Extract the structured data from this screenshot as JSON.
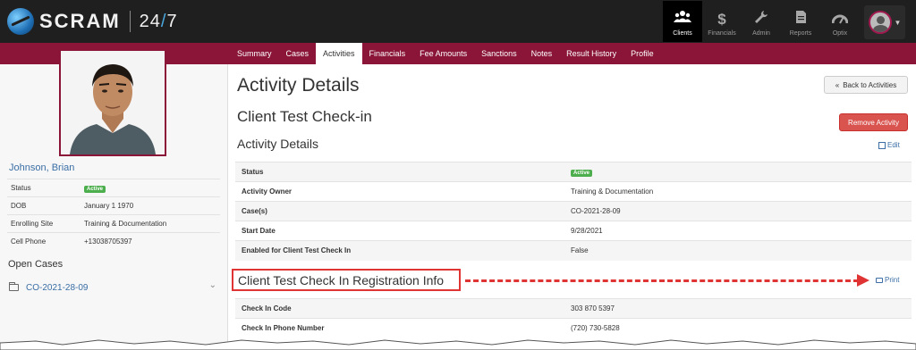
{
  "brand": {
    "name": "SCRAM",
    "suffix_1": "24",
    "slash": "/",
    "suffix_2": "7"
  },
  "nav": {
    "items": [
      {
        "label": "Clients",
        "icon": "users-icon",
        "active": true
      },
      {
        "label": "Financials",
        "icon": "dollar-icon",
        "active": false
      },
      {
        "label": "Admin",
        "icon": "wrench-icon",
        "active": false
      },
      {
        "label": "Reports",
        "icon": "document-icon",
        "active": false
      },
      {
        "label": "Optix",
        "icon": "gauge-icon",
        "active": false
      }
    ],
    "user_menu_icon": "user-avatar-icon"
  },
  "tabs": [
    "Summary",
    "Cases",
    "Activities",
    "Financials",
    "Fee Amounts",
    "Sanctions",
    "Notes",
    "Result History",
    "Profile"
  ],
  "active_tab": "Activities",
  "client": {
    "name": "Johnson, Brian",
    "fields": [
      {
        "label": "Status",
        "value": "Active",
        "badge": true
      },
      {
        "label": "DOB",
        "value": "January 1 1970"
      },
      {
        "label": "Enrolling Site",
        "value": "Training & Documentation"
      },
      {
        "label": "Cell Phone",
        "value": "+13038705397"
      }
    ]
  },
  "open_cases": {
    "title": "Open Cases",
    "items": [
      "CO-2021-28-09"
    ]
  },
  "main": {
    "page_title": "Activity Details",
    "back_button": "Back to Activities",
    "activity_name": "Client Test Check-in",
    "remove_button": "Remove Activity",
    "section_title": "Activity Details",
    "edit_label": "Edit",
    "details": [
      {
        "label": "Status",
        "value": "Active",
        "badge": true
      },
      {
        "label": "Activity Owner",
        "value": "Training & Documentation"
      },
      {
        "label": "Case(s)",
        "value": "CO-2021-28-09"
      },
      {
        "label": "Start Date",
        "value": "9/28/2021"
      },
      {
        "label": "Enabled for Client Test Check In",
        "value": "False"
      }
    ],
    "registration_title": "Client Test Check In Registration Info",
    "print_label": "Print",
    "registration": [
      {
        "label": "Check In Code",
        "value": "303 870 5397"
      },
      {
        "label": "Check In Phone Number",
        "value": "(720) 730-5828"
      }
    ]
  },
  "colors": {
    "accent": "#8a1538",
    "link": "#3a6ea5",
    "danger": "#d9534f",
    "success": "#4cae4c",
    "annotation": "#e03434"
  }
}
